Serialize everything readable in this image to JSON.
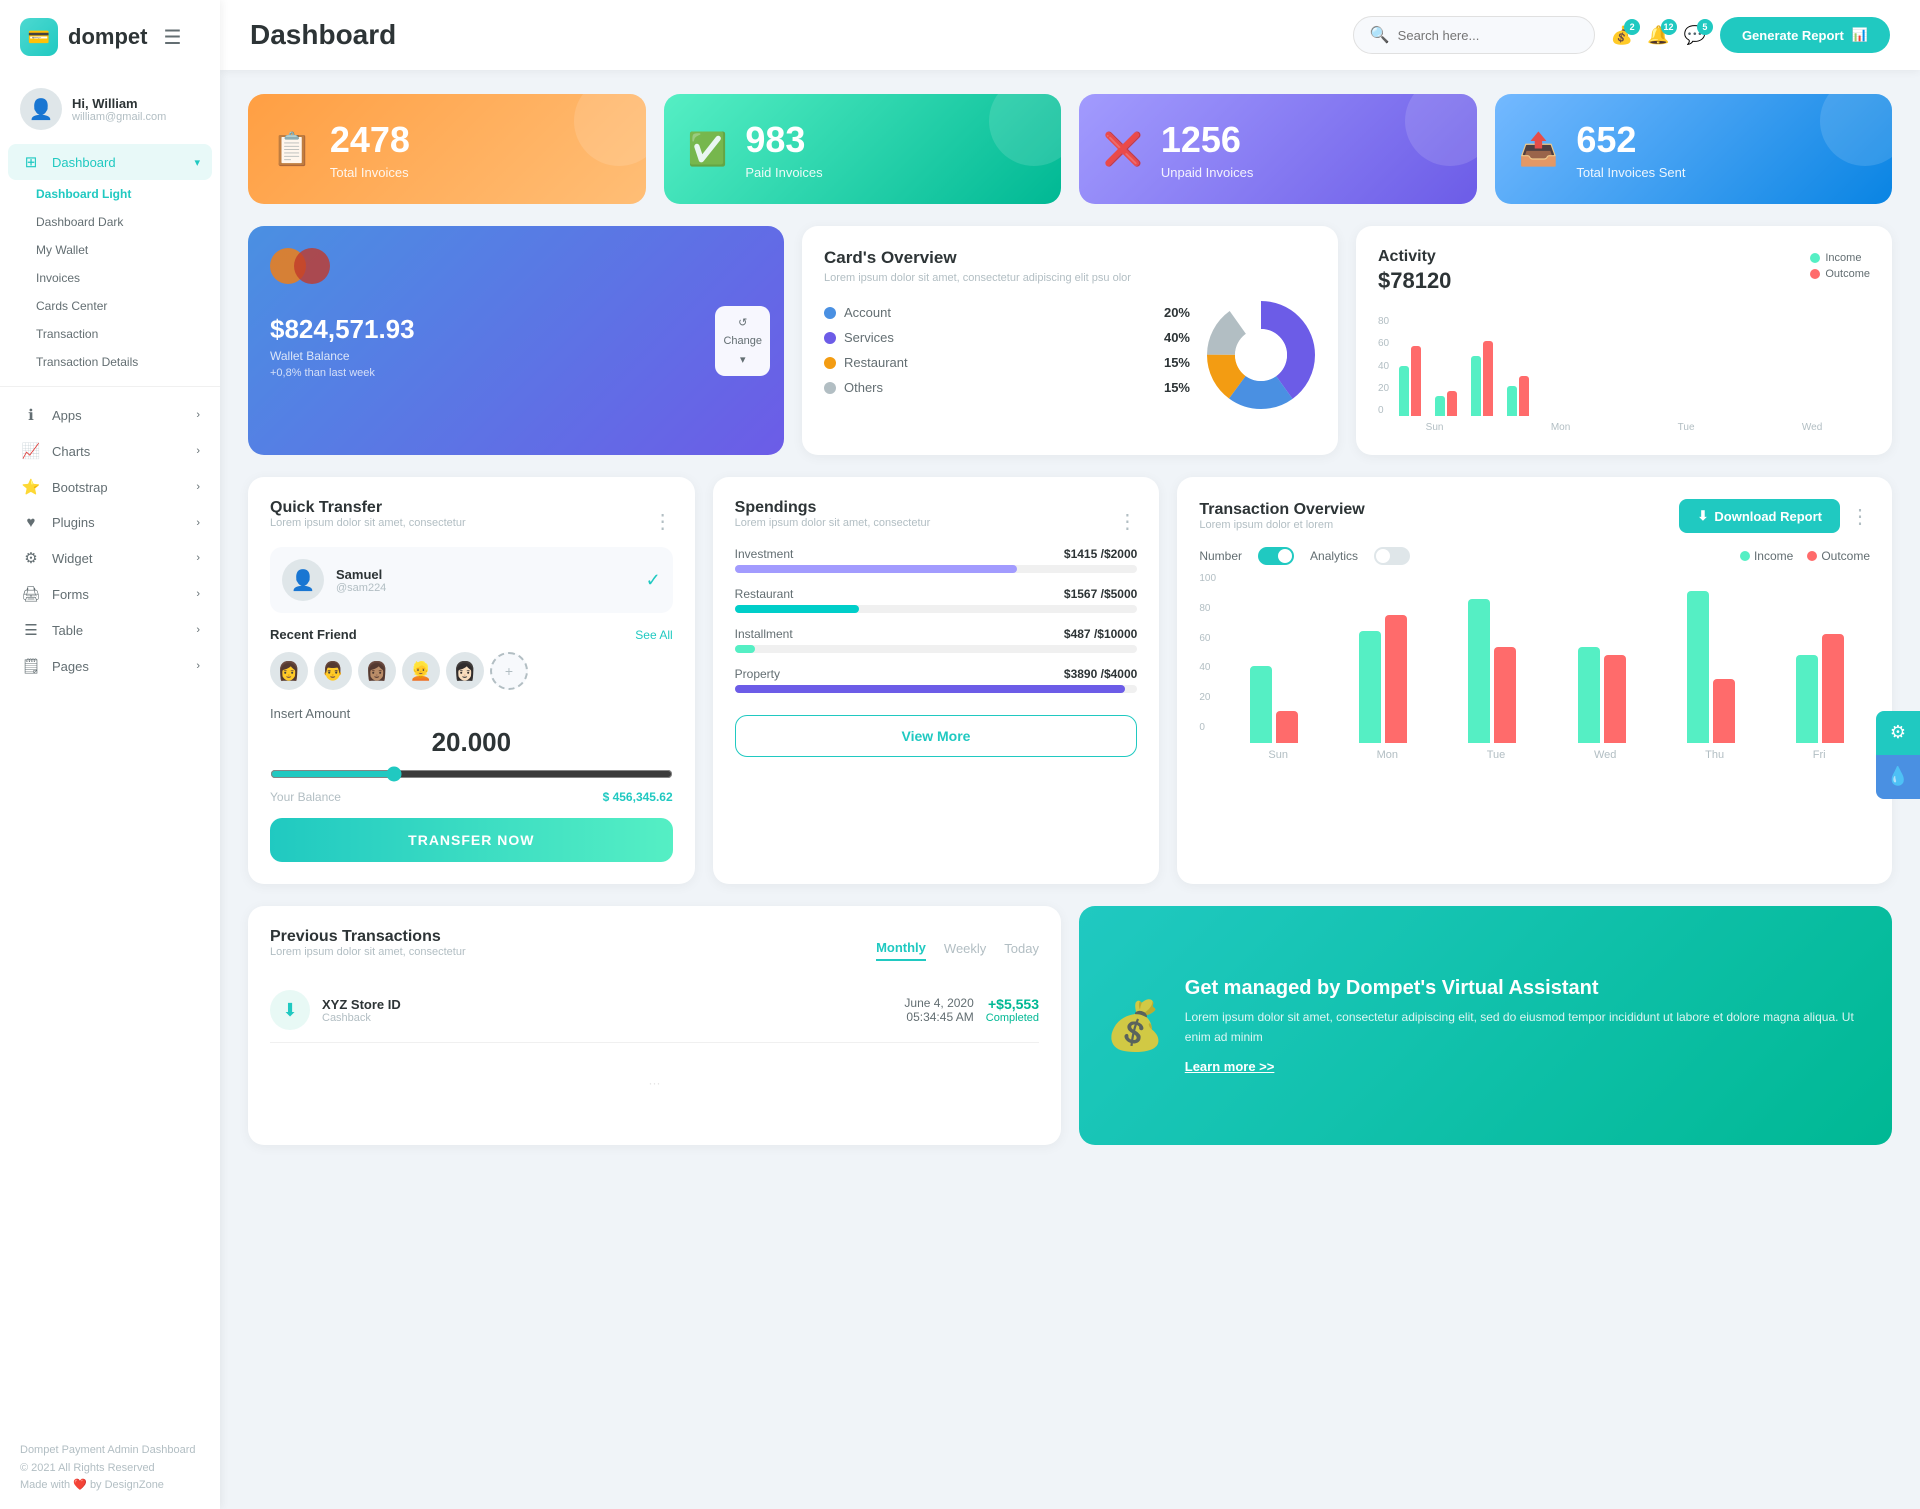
{
  "app": {
    "logo": "dompet",
    "logo_icon": "💳"
  },
  "user": {
    "greeting": "Hi, William",
    "email": "william@gmail.com"
  },
  "header": {
    "title": "Dashboard",
    "search_placeholder": "Search here...",
    "generate_btn": "Generate Report",
    "badges": {
      "wallet": "2",
      "bell": "12",
      "chat": "5"
    }
  },
  "sidebar": {
    "dashboard_label": "Dashboard",
    "sub_items": [
      {
        "label": "Dashboard Light",
        "active": true
      },
      {
        "label": "Dashboard Dark",
        "active": false
      },
      {
        "label": "My Wallet",
        "active": false
      },
      {
        "label": "Invoices",
        "active": false
      },
      {
        "label": "Cards Center",
        "active": false
      },
      {
        "label": "Transaction",
        "active": false
      },
      {
        "label": "Transaction Details",
        "active": false
      }
    ],
    "nav_items": [
      {
        "label": "Apps",
        "icon": "ℹ️",
        "has_children": true
      },
      {
        "label": "Charts",
        "icon": "📈",
        "has_children": true
      },
      {
        "label": "Bootstrap",
        "icon": "⭐",
        "has_children": true
      },
      {
        "label": "Plugins",
        "icon": "❤️",
        "has_children": true
      },
      {
        "label": "Widget",
        "icon": "⚙️",
        "has_children": true
      },
      {
        "label": "Forms",
        "icon": "🖨️",
        "has_children": true
      },
      {
        "label": "Table",
        "icon": "☰",
        "has_children": true
      },
      {
        "label": "Pages",
        "icon": "🗒️",
        "has_children": true
      }
    ],
    "footer_line1": "Dompet Payment Admin Dashboard",
    "footer_line2": "© 2021 All Rights Reserved",
    "footer_line3": "Made with ❤️ by DesignZone"
  },
  "stats": [
    {
      "value": "2478",
      "label": "Total Invoices",
      "color": "orange",
      "icon": "📋"
    },
    {
      "value": "983",
      "label": "Paid Invoices",
      "color": "green",
      "icon": "✅"
    },
    {
      "value": "1256",
      "label": "Unpaid Invoices",
      "color": "purple",
      "icon": "❌"
    },
    {
      "value": "652",
      "label": "Total Invoices Sent",
      "color": "blue",
      "icon": "📤"
    }
  ],
  "wallet": {
    "amount": "$824,571.93",
    "label": "Wallet Balance",
    "change": "+0,8% than last week",
    "change_btn": "Change"
  },
  "cards_overview": {
    "title": "Card's Overview",
    "subtitle": "Lorem ipsum dolor sit amet, consectetur adipiscing elit psu olor",
    "items": [
      {
        "label": "Account",
        "pct": "20%",
        "color": "#4a90e2"
      },
      {
        "label": "Services",
        "pct": "40%",
        "color": "#6c5ce7"
      },
      {
        "label": "Restaurant",
        "pct": "15%",
        "color": "#f39c12"
      },
      {
        "label": "Others",
        "pct": "15%",
        "color": "#b2bec3"
      }
    ]
  },
  "activity": {
    "title": "Activity",
    "amount": "$78120",
    "income_label": "Income",
    "outcome_label": "Outcome",
    "bars": [
      {
        "day": "Sun",
        "income": 50,
        "outcome": 70
      },
      {
        "day": "Mon",
        "income": 20,
        "outcome": 25
      },
      {
        "day": "Tue",
        "income": 60,
        "outcome": 75
      },
      {
        "day": "Wed",
        "income": 30,
        "outcome": 40
      }
    ]
  },
  "quick_transfer": {
    "title": "Quick Transfer",
    "subtitle": "Lorem ipsum dolor sit amet, consectetur",
    "user_name": "Samuel",
    "user_handle": "@sam224",
    "recent_friends_label": "Recent Friend",
    "see_all": "See All",
    "insert_amount_label": "Insert Amount",
    "amount": "20.000",
    "balance_label": "Your Balance",
    "balance_value": "$ 456,345.62",
    "transfer_btn": "TRANSFER NOW"
  },
  "spendings": {
    "title": "Spendings",
    "subtitle": "Lorem ipsum dolor sit amet, consectetur",
    "items": [
      {
        "label": "Investment",
        "amount": "$1415",
        "max": "$2000",
        "pct": 70,
        "color": "#a29bfe"
      },
      {
        "label": "Restaurant",
        "amount": "$1567",
        "max": "$5000",
        "pct": 31,
        "color": "#00cec9"
      },
      {
        "label": "Installment",
        "amount": "$487",
        "max": "$10000",
        "pct": 5,
        "color": "#55efc4"
      },
      {
        "label": "Property",
        "amount": "$3890",
        "max": "$4000",
        "pct": 97,
        "color": "#6c5ce7"
      }
    ],
    "view_more_btn": "View More"
  },
  "transaction_overview": {
    "title": "Transaction Overview",
    "subtitle": "Lorem ipsum dolor et lorem",
    "download_btn": "Download Report",
    "number_label": "Number",
    "analytics_label": "Analytics",
    "income_label": "Income",
    "outcome_label": "Outcome",
    "bars": [
      {
        "day": "Sun",
        "income": 48,
        "outcome": 20
      },
      {
        "day": "Mon",
        "income": 70,
        "outcome": 80
      },
      {
        "day": "Tue",
        "income": 90,
        "outcome": 60
      },
      {
        "day": "Wed",
        "income": 60,
        "outcome": 55
      },
      {
        "day": "Thu",
        "income": 95,
        "outcome": 40
      },
      {
        "day": "Fri",
        "income": 55,
        "outcome": 68
      }
    ]
  },
  "prev_transactions": {
    "title": "Previous Transactions",
    "subtitle": "Lorem ipsum dolor sit amet, consectetur",
    "tabs": [
      "Monthly",
      "Weekly",
      "Today"
    ],
    "active_tab": "Monthly",
    "items": [
      {
        "name": "XYZ Store ID",
        "type": "Cashback",
        "date": "June 4, 2020",
        "time": "05:34:45 AM",
        "amount": "+$5,553",
        "status": "Completed"
      }
    ]
  },
  "va_card": {
    "title": "Get managed by Dompet's Virtual Assistant",
    "description": "Lorem ipsum dolor sit amet, consectetur adipiscing elit, sed do eiusmod tempor incididunt ut labore et dolore magna aliqua. Ut enim ad minim",
    "link": "Learn more >>"
  }
}
